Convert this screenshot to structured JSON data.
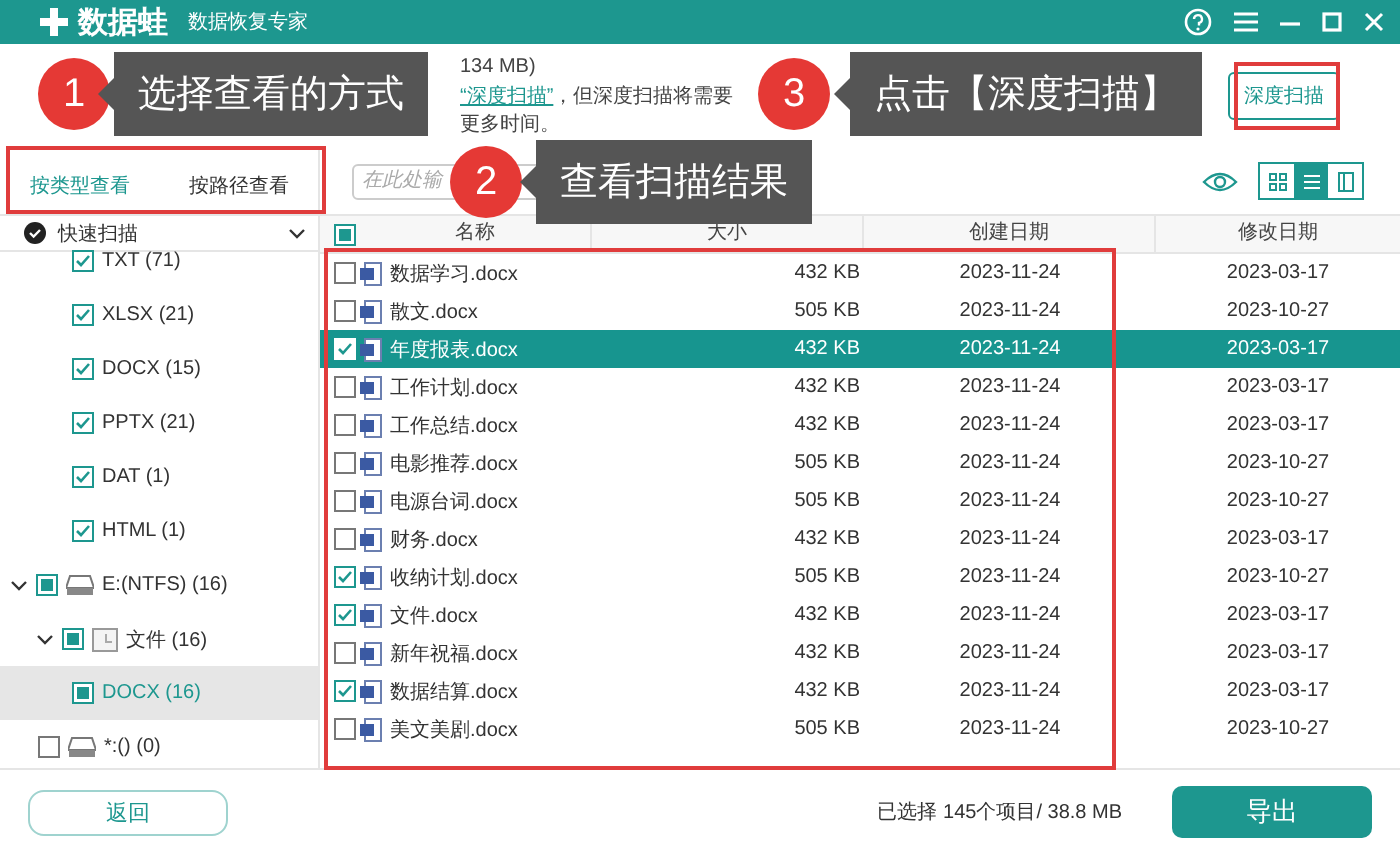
{
  "window": {
    "app_name": "数据蛙",
    "subtitle": "数据恢复专家"
  },
  "scan_info": {
    "size_fragment": "134 MB)",
    "link": "“深度扫描”",
    "note": "，但深度扫描将需要更多时间。"
  },
  "deep_scan_button": "深度扫描",
  "view_tabs": [
    {
      "label": "按类型查看",
      "selected": true
    },
    {
      "label": "按路径查看",
      "selected": false
    }
  ],
  "search": {
    "placeholder": "在此处输"
  },
  "view_modes": [
    {
      "kind": "grid",
      "selected": false
    },
    {
      "kind": "list",
      "selected": true
    },
    {
      "kind": "detail",
      "selected": false
    }
  ],
  "sidebar": {
    "header": "快速扫描",
    "tree": [
      {
        "label": "TXT (71)",
        "kind": "type",
        "checked": true,
        "indeterminate": false,
        "selected": false
      },
      {
        "label": "XLSX (21)",
        "kind": "type",
        "checked": true,
        "indeterminate": false,
        "selected": false
      },
      {
        "label": "DOCX (15)",
        "kind": "type",
        "checked": true,
        "indeterminate": false,
        "selected": false
      },
      {
        "label": "PPTX (21)",
        "kind": "type",
        "checked": true,
        "indeterminate": false,
        "selected": false
      },
      {
        "label": "DAT (1)",
        "kind": "type",
        "checked": true,
        "indeterminate": false,
        "selected": false
      },
      {
        "label": "HTML (1)",
        "kind": "type",
        "checked": true,
        "indeterminate": false,
        "selected": false
      },
      {
        "label": "E:(NTFS) (16)",
        "kind": "drive",
        "checked": false,
        "indeterminate": true,
        "selected": false,
        "expanded": true,
        "children": [
          {
            "label": "文件 (16)",
            "kind": "folder",
            "checked": false,
            "indeterminate": true,
            "selected": false,
            "expanded": true,
            "children": [
              {
                "label": "DOCX (16)",
                "kind": "type",
                "checked": false,
                "indeterminate": true,
                "selected": true
              }
            ]
          }
        ]
      },
      {
        "label": "*:() (0)",
        "kind": "drive",
        "checked": false,
        "indeterminate": false,
        "selected": false
      }
    ]
  },
  "table": {
    "header_checked": false,
    "header_indeterminate": true,
    "columns": [
      "名称",
      "大小",
      "创建日期",
      "修改日期"
    ],
    "rows": [
      {
        "name": "数据学习.docx",
        "size": "432 KB",
        "created": "2023-11-24",
        "modified": "2023-03-17",
        "checked": false,
        "selected": false
      },
      {
        "name": "散文.docx",
        "size": "505 KB",
        "created": "2023-11-24",
        "modified": "2023-10-27",
        "checked": false,
        "selected": false
      },
      {
        "name": "年度报表.docx",
        "size": "432 KB",
        "created": "2023-11-24",
        "modified": "2023-03-17",
        "checked": true,
        "selected": true
      },
      {
        "name": "工作计划.docx",
        "size": "432 KB",
        "created": "2023-11-24",
        "modified": "2023-03-17",
        "checked": false,
        "selected": false
      },
      {
        "name": "工作总结.docx",
        "size": "432 KB",
        "created": "2023-11-24",
        "modified": "2023-03-17",
        "checked": false,
        "selected": false
      },
      {
        "name": "电影推荐.docx",
        "size": "505 KB",
        "created": "2023-11-24",
        "modified": "2023-10-27",
        "checked": false,
        "selected": false
      },
      {
        "name": "电源台词.docx",
        "size": "505 KB",
        "created": "2023-11-24",
        "modified": "2023-10-27",
        "checked": false,
        "selected": false
      },
      {
        "name": "财务.docx",
        "size": "432 KB",
        "created": "2023-11-24",
        "modified": "2023-03-17",
        "checked": false,
        "selected": false
      },
      {
        "name": "收纳计划.docx",
        "size": "505 KB",
        "created": "2023-11-24",
        "modified": "2023-10-27",
        "checked": true,
        "selected": false
      },
      {
        "name": "文件.docx",
        "size": "432 KB",
        "created": "2023-11-24",
        "modified": "2023-03-17",
        "checked": true,
        "selected": false
      },
      {
        "name": "新年祝福.docx",
        "size": "432 KB",
        "created": "2023-11-24",
        "modified": "2023-03-17",
        "checked": false,
        "selected": false
      },
      {
        "name": "数据结算.docx",
        "size": "432 KB",
        "created": "2023-11-24",
        "modified": "2023-03-17",
        "checked": true,
        "selected": false
      },
      {
        "name": "美文美剧.docx",
        "size": "505 KB",
        "created": "2023-11-24",
        "modified": "2023-10-27",
        "checked": false,
        "selected": false
      }
    ]
  },
  "footer": {
    "back_button": "返回",
    "summary": "已选择 145个项目/ 38.8 MB",
    "export_button": "导出"
  },
  "annotations": [
    {
      "number": "1",
      "text": "选择查看的方式"
    },
    {
      "number": "2",
      "text": "查看扫描结果"
    },
    {
      "number": "3",
      "text": "点击【深度扫描】"
    }
  ]
}
